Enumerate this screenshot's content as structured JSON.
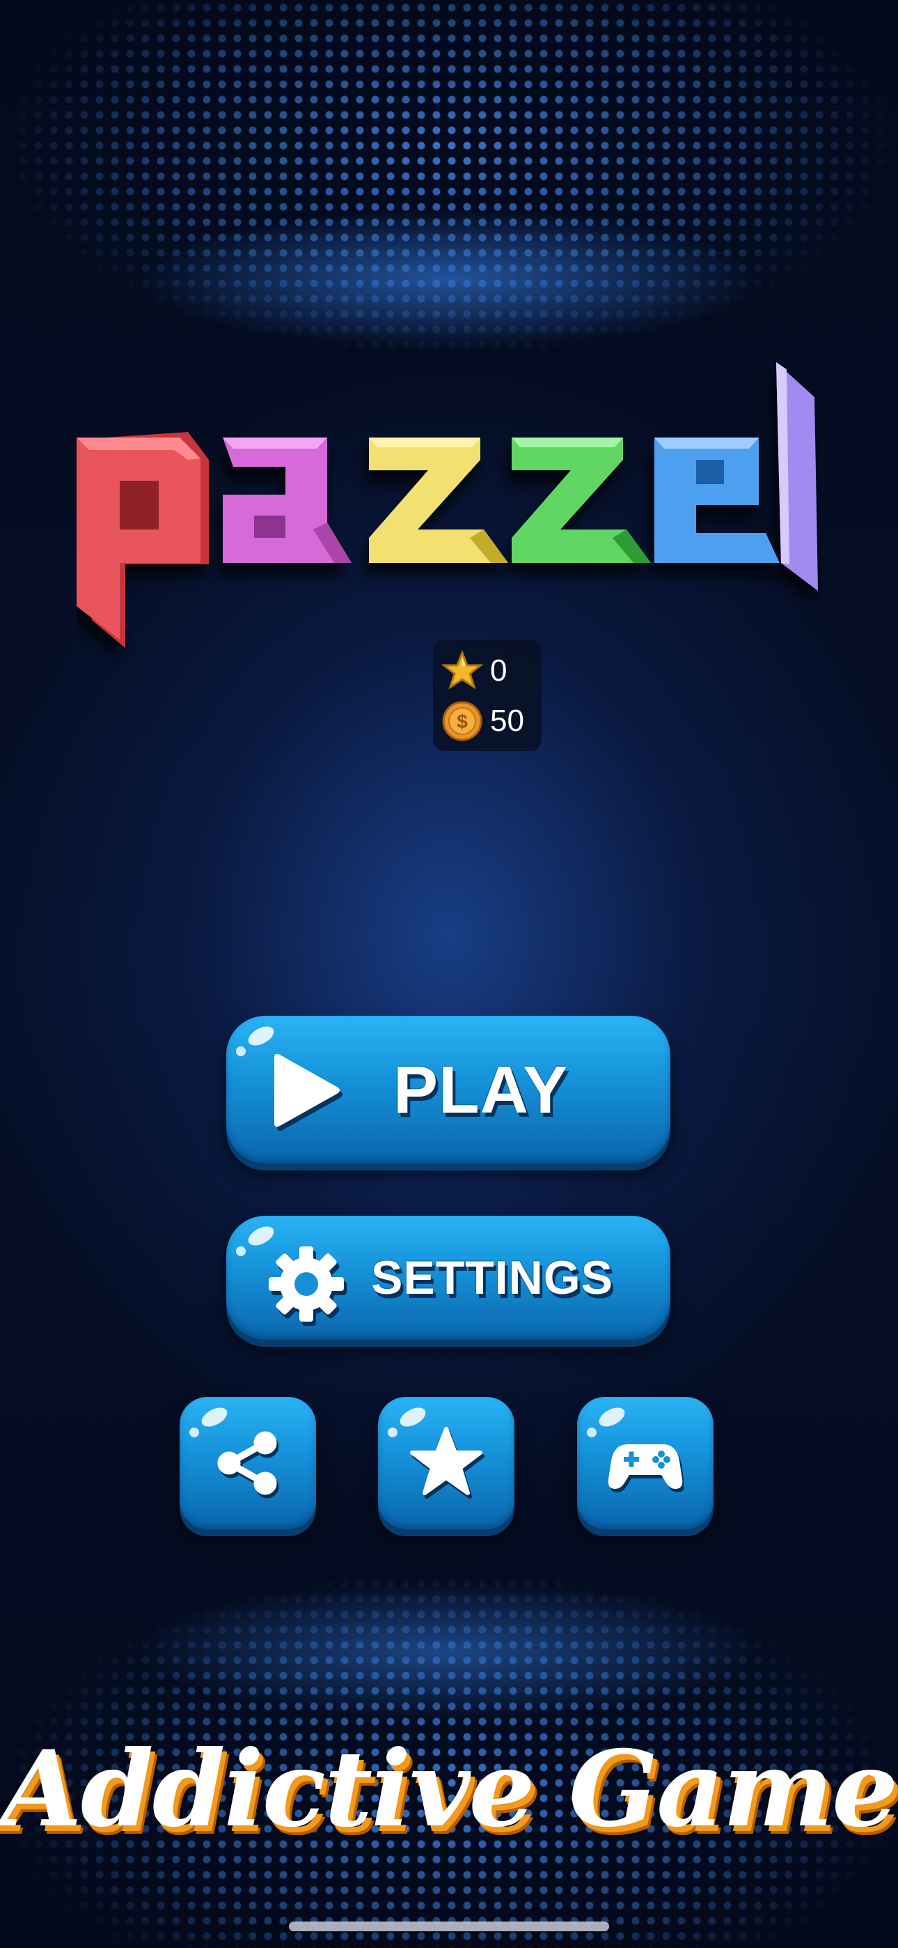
{
  "game": {
    "logo_text": "pazzel",
    "logo_letters": [
      {
        "char": "p",
        "color": "#e8555c"
      },
      {
        "char": "a",
        "color": "#d66ad8"
      },
      {
        "char": "z",
        "color": "#f2e170"
      },
      {
        "char": "z",
        "color": "#62d664"
      },
      {
        "char": "e",
        "color": "#4ea0f0"
      },
      {
        "char": "l",
        "color": "#a18af0"
      }
    ]
  },
  "currency": {
    "stars": "0",
    "coins": "50",
    "star_icon": "star-icon",
    "coin_icon": "coin-icon"
  },
  "menu": {
    "play_label": "PLAY",
    "play_icon": "play-icon",
    "settings_label": "SETTINGS",
    "settings_icon": "gear-icon",
    "small_buttons": [
      {
        "icon": "share-icon"
      },
      {
        "icon": "star-icon"
      },
      {
        "icon": "gamepad-icon"
      }
    ]
  },
  "tagline": "Addictive Game",
  "colors": {
    "button_top": "#29b3f5",
    "button_bottom": "#0a66ad",
    "tagline_shadow": "#f29a1c",
    "background": "#06102a"
  }
}
